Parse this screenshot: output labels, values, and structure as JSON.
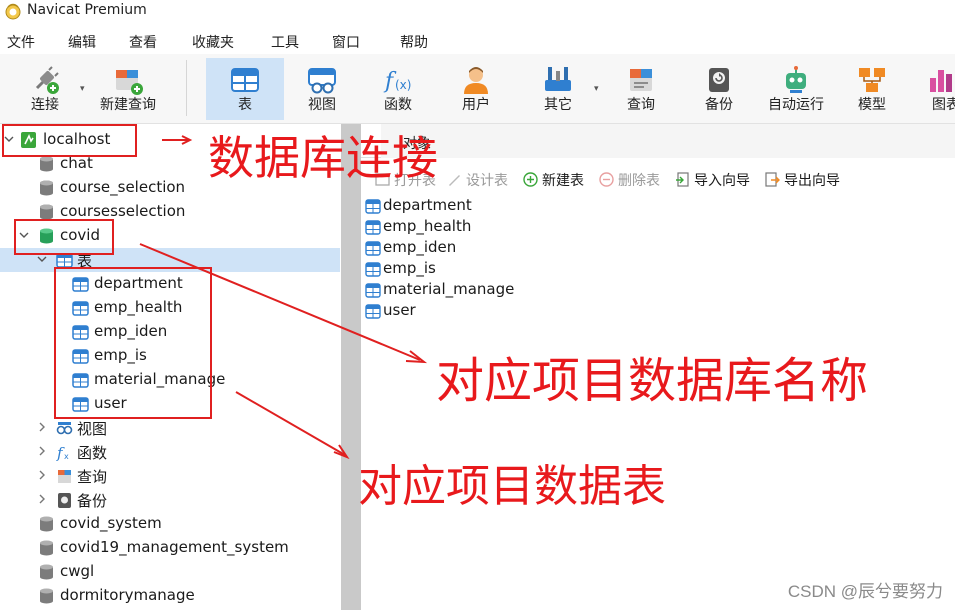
{
  "app": {
    "title": "Navicat Premium"
  },
  "menu": [
    "文件",
    "编辑",
    "查看",
    "收藏夹",
    "工具",
    "窗口",
    "帮助"
  ],
  "toolbar": {
    "connect": "连接",
    "new_query": "新建查询",
    "table": "表",
    "view": "视图",
    "function": "函数",
    "user": "用户",
    "other": "其它",
    "query": "查询",
    "backup": "备份",
    "autorun": "自动运行",
    "model": "模型",
    "chart": "图表"
  },
  "tree": {
    "connection": "localhost",
    "databases_before": [
      "chat",
      "course_selection",
      "coursesselection"
    ],
    "open_db": "covid",
    "tables_node": "表",
    "tables": [
      "department",
      "emp_health",
      "emp_iden",
      "emp_is",
      "material_manage",
      "user"
    ],
    "view_node": "视图",
    "function_node": "函数",
    "query_node": "查询",
    "backup_node": "备份",
    "databases_after": [
      "covid_system",
      "covid19_management_system",
      "cwgl",
      "dormitorymanage"
    ]
  },
  "objects": {
    "tab_label": "对象",
    "toolbar": {
      "open_table": "打开表",
      "design_table": "设计表",
      "new_table": "新建表",
      "delete_table": "删除表",
      "import_wizard": "导入向导",
      "export_wizard": "导出向导"
    },
    "tables": [
      "department",
      "emp_health",
      "emp_iden",
      "emp_is",
      "material_manage",
      "user"
    ]
  },
  "annotations": {
    "db_connection": "数据库连接",
    "project_db_name": "对应项目数据库名称",
    "project_tables": "对应项目数据表",
    "color": "#e8191c"
  },
  "watermark": "CSDN @辰兮要努力"
}
